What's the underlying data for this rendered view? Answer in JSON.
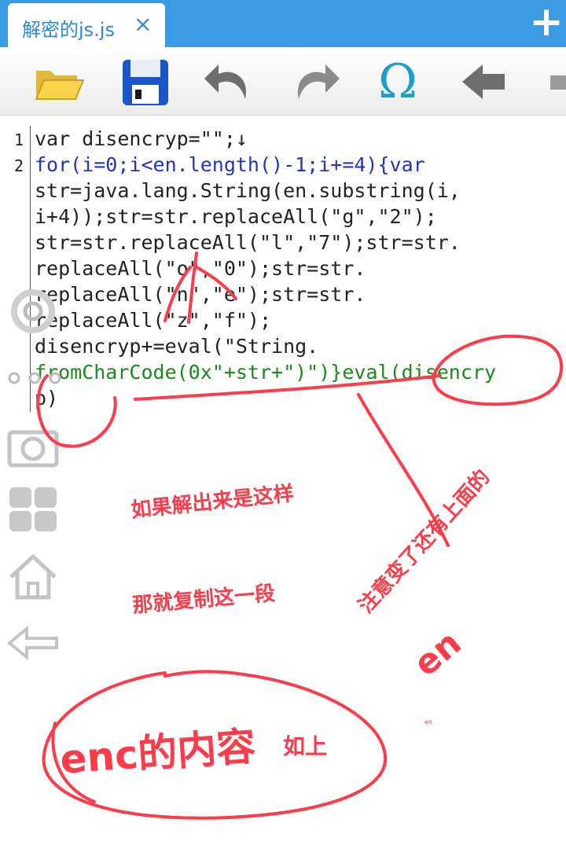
{
  "tab": {
    "title": "解密的js.js",
    "close_icon": "×",
    "add_icon": "+"
  },
  "toolbar": {
    "items": [
      "open-folder-icon",
      "save-icon",
      "undo-icon",
      "redo-icon",
      "omega-icon",
      "back-arrow-icon",
      "more-icon"
    ],
    "omega_glyph": "Ω"
  },
  "editor": {
    "line_numbers": [
      "1",
      "2"
    ],
    "lines": [
      "var disencryp=\"\";↓",
      "for(i=0;i<en.length()-1;i+=4){var",
      "str=java.lang.String(en.substring(i,",
      "i+4));str=str.replaceAll(\"g\",\"2\");",
      "str=str.replaceAll(\"l\",\"7\");str=str.",
      "replaceAll(\"o\",\"0\");str=str.",
      "replaceAll(\"n\",\"e\");str=str.",
      "replaceAll(\"z\",\"f\");",
      "disencryp+=eval(\"String.",
      "fromCharCode(0x\"+str+\")\")}eval(disencry",
      "p)"
    ]
  },
  "side_icons": [
    "settings-icon",
    "camera-icon",
    "apps-grid-icon",
    "home-icon",
    "back-icon"
  ],
  "annotations": {
    "text1": "如果解出来是这样",
    "text2": "那就复制这一段",
    "text3": "注意变了还有上面的",
    "text4": "en",
    "text5": "enc的内容",
    "text6": "如上",
    "text7": "en"
  },
  "colors": {
    "tabbar": "#3a9be3",
    "annotation": "#ff3b4a",
    "keyword": "#2233c8",
    "string": "#1a8a1a"
  }
}
